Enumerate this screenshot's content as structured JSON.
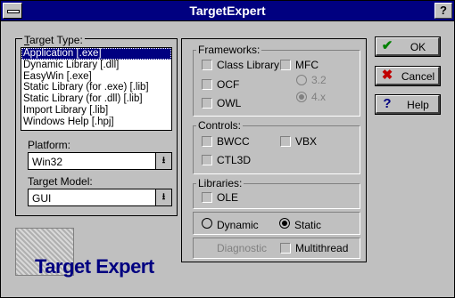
{
  "window": {
    "title": "TargetExpert",
    "help_glyph": "?"
  },
  "target_type": {
    "label": "Target Type:",
    "items": [
      "Application [.exe]",
      "Dynamic Library [.dll]",
      "EasyWin [.exe]",
      "Static Library (for .exe) [.lib]",
      "Static Library (for .dll) [.lib]",
      "Import Library [.lib]",
      "Windows Help [.hpj]"
    ],
    "selected_index": 0
  },
  "platform": {
    "label": "Platform:",
    "value": "Win32"
  },
  "target_model": {
    "label": "Target Model:",
    "value": "GUI"
  },
  "frameworks": {
    "label": "Frameworks:",
    "class_library": "Class Library",
    "mfc": "MFC",
    "ocf": "OCF",
    "owl": "OWL",
    "mfc_v32": "3.2",
    "mfc_v4x": "4.x"
  },
  "controls": {
    "label": "Controls:",
    "bwcc": "BWCC",
    "vbx": "VBX",
    "ctl3d": "CTL3D"
  },
  "libraries": {
    "label": "Libraries:",
    "ole": "OLE"
  },
  "linking": {
    "dynamic": "Dynamic",
    "static": "Static",
    "selected": "Static"
  },
  "options": {
    "diagnostic": "Diagnostic",
    "multithread": "Multithread"
  },
  "buttons": {
    "ok": "OK",
    "cancel": "Cancel",
    "help": "Help"
  },
  "logo": {
    "text": "Target Expert"
  },
  "colors": {
    "titlebar": "#000080",
    "face": "#c0c0c0",
    "selection": "#000080"
  }
}
